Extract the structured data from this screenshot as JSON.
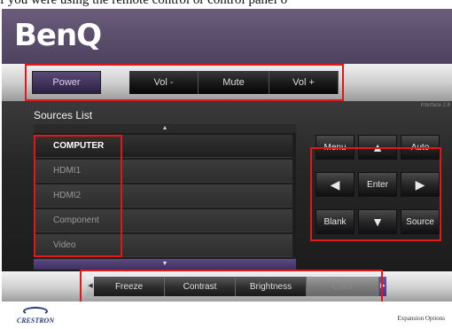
{
  "caption": "f you were using the remote control or control panel o",
  "header": {
    "logo": "BenQ"
  },
  "top_controls": {
    "power": "Power",
    "vol_down": "Vol -",
    "mute": "Mute",
    "vol_up": "Vol +"
  },
  "main": {
    "interface_version": "Interface 2.8",
    "sources_title": "Sources List",
    "scroll_up": "▲",
    "scroll_down": "▼",
    "sources": [
      "COMPUTER",
      "HDMI1",
      "HDMI2",
      "Component",
      "Video"
    ],
    "selected_source": "COMPUTER"
  },
  "nav_pad": {
    "menu": "Menu",
    "up": "▲",
    "auto": "Auto",
    "left": "◀",
    "enter": "Enter",
    "right": "▶",
    "blank": "Blank",
    "down": "▼",
    "source": "Source"
  },
  "bottom_controls": {
    "left_arrow": "◀",
    "right_arrow": "▶",
    "freeze": "Freeze",
    "contrast": "Contrast",
    "brightness": "Brightness",
    "color": "Color"
  },
  "footer": {
    "brand": "CRESTRON",
    "expansion": "Expansion Options"
  },
  "colors": {
    "accent_purple": "#4a3b66",
    "highlight_red": "#e01818"
  }
}
